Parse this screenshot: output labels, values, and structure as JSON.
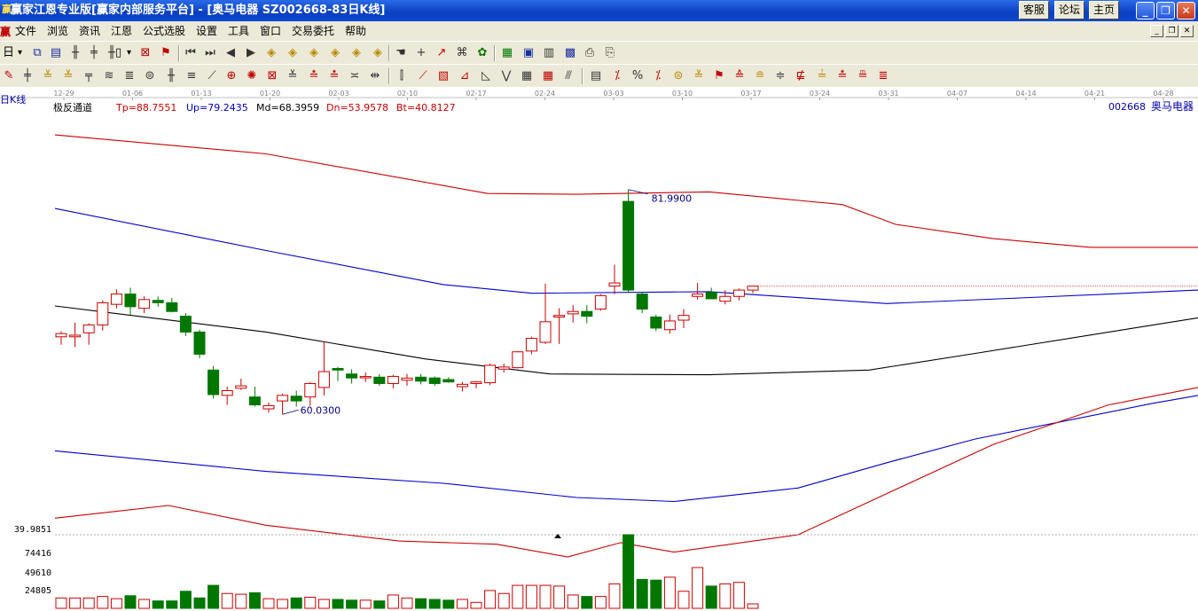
{
  "window": {
    "title": "赢家江恩专业版[赢家内部服务平台] - [奥马电器   SZ002668-83日K线]",
    "buttons": [
      "客服",
      "论坛",
      "主页"
    ],
    "controls": [
      "_",
      "❐",
      "✕"
    ]
  },
  "menu": {
    "logo": "赢",
    "items": [
      "文件",
      "浏览",
      "资讯",
      "江恩",
      "公式选股",
      "设置",
      "工具",
      "窗口",
      "交易委托",
      "帮助"
    ],
    "mdi_controls": [
      "_",
      "❐",
      "✕"
    ]
  },
  "toolbar": {
    "period_label": "日",
    "period_arrow": "▾",
    "cursor_label": "▯",
    "cursor_arrow": "▾"
  },
  "chart": {
    "left_label": "日K线",
    "indicator_name": "极反通道",
    "params": [
      {
        "label": "Tp=88.7551",
        "color": "#cc0000"
      },
      {
        "label": "Up=79.2435",
        "color": "#0000cc"
      },
      {
        "label": "Md=68.3959",
        "color": "#000000"
      },
      {
        "label": "Dn=53.9578",
        "color": "#cc0000"
      },
      {
        "label": "Bt=40.8127",
        "color": "#cc0000"
      }
    ],
    "stock_code": "002668",
    "stock_name": "奥马电器",
    "date_ticks": [
      "12-29",
      "01-06",
      "01-13",
      "01-20",
      "02-03",
      "02-10",
      "02-17",
      "02-24",
      "03-03",
      "03-10",
      "03-17",
      "03-24",
      "03-31",
      "04-07",
      "04-14",
      "04-21",
      "04-28"
    ],
    "high_label": "81.9900",
    "low_label": "60.0300",
    "volume_ticks": [
      "39.9851",
      "74416",
      "49610",
      "24805"
    ],
    "colors": {
      "up": "#cc0000",
      "down": "#007700",
      "top": "#cc0000",
      "upper": "#0000cc",
      "mid": "#000000"
    }
  },
  "chart_data": {
    "type": "candlestick",
    "price_range": [
      38.4,
      91.6
    ],
    "volume_max": 99220,
    "candles": [
      [
        63.4,
        64.1,
        62.4,
        63.8
      ],
      [
        63.4,
        65.2,
        62.1,
        63.6
      ],
      [
        63.9,
        65.1,
        62.4,
        64.9
      ],
      [
        64.9,
        68.0,
        64.2,
        67.7
      ],
      [
        67.5,
        69.4,
        67.0,
        68.8
      ],
      [
        68.8,
        69.6,
        66.1,
        67.2
      ],
      [
        67.0,
        68.5,
        66.4,
        68.1
      ],
      [
        68.0,
        68.5,
        67.2,
        67.7
      ],
      [
        67.7,
        68.3,
        66.5,
        66.6
      ],
      [
        66.0,
        66.4,
        63.5,
        64.0
      ],
      [
        64.0,
        64.3,
        60.7,
        61.2
      ],
      [
        59.2,
        59.7,
        55.6,
        56.1
      ],
      [
        56.0,
        57.1,
        54.8,
        56.6
      ],
      [
        56.9,
        58.1,
        56.7,
        57.2
      ],
      [
        55.8,
        57.1,
        54.6,
        54.8
      ],
      [
        54.3,
        55.1,
        53.8,
        54.7
      ],
      [
        55.3,
        56.2,
        53.6,
        56.0
      ],
      [
        55.9,
        56.6,
        54.6,
        55.3
      ],
      [
        55.8,
        57.7,
        54.7,
        57.5
      ],
      [
        57.0,
        62.8,
        56.0,
        59.0
      ],
      [
        59.4,
        59.6,
        57.8,
        59.2
      ],
      [
        58.7,
        59.3,
        57.5,
        58.2
      ],
      [
        58.3,
        58.9,
        57.7,
        58.3
      ],
      [
        58.3,
        58.7,
        57.2,
        57.5
      ],
      [
        57.5,
        58.6,
        56.9,
        58.4
      ],
      [
        58.0,
        58.7,
        57.2,
        58.1
      ],
      [
        58.3,
        58.7,
        57.4,
        57.8
      ],
      [
        58.2,
        58.4,
        57.2,
        57.5
      ],
      [
        58.0,
        58.3,
        57.6,
        57.7
      ],
      [
        57.1,
        57.7,
        56.5,
        57.4
      ],
      [
        57.5,
        57.8,
        56.9,
        57.7
      ],
      [
        57.6,
        60.0,
        57.3,
        59.8
      ],
      [
        59.4,
        60.0,
        58.9,
        59.5
      ],
      [
        59.5,
        61.6,
        59.4,
        61.5
      ],
      [
        61.6,
        63.4,
        61.2,
        63.2
      ],
      [
        62.7,
        70.1,
        62.5,
        65.3
      ],
      [
        65.9,
        67.0,
        62.5,
        66.1
      ],
      [
        66.3,
        67.4,
        65.2,
        66.6
      ],
      [
        66.6,
        67.4,
        65.1,
        66.0
      ],
      [
        66.9,
        68.8,
        66.7,
        68.6
      ],
      [
        69.8,
        72.5,
        68.8,
        70.2
      ],
      [
        80.5,
        82.0,
        69.0,
        69.3
      ],
      [
        68.8,
        69.1,
        66.4,
        66.9
      ],
      [
        65.9,
        66.2,
        64.1,
        64.5
      ],
      [
        64.3,
        66.2,
        63.8,
        65.4
      ],
      [
        65.5,
        66.9,
        64.5,
        66.1
      ],
      [
        68.5,
        70.2,
        68.1,
        68.8
      ],
      [
        69.0,
        69.6,
        68.3,
        68.2
      ],
      [
        67.9,
        69.3,
        67.5,
        68.5
      ],
      [
        68.5,
        69.5,
        68.0,
        69.3
      ],
      [
        69.3,
        69.7,
        68.9,
        69.8
      ]
    ],
    "volumes": [
      14000,
      14000,
      14000,
      16000,
      13000,
      17000,
      12000,
      10000,
      10000,
      23000,
      14000,
      31000,
      20000,
      19000,
      21000,
      13000,
      12000,
      14000,
      15000,
      12000,
      12000,
      11000,
      11000,
      10000,
      18000,
      14000,
      13000,
      12000,
      11000,
      12000,
      8000,
      24000,
      20000,
      31000,
      31000,
      31000,
      30000,
      18000,
      16000,
      16000,
      33000,
      99220,
      39000,
      38000,
      42000,
      23000,
      55000,
      30000,
      33000,
      35000,
      6000
    ],
    "bands": {
      "tp": [
        [
          62,
          88.9
        ],
        [
          300,
          86.5
        ],
        [
          550,
          81.5
        ],
        [
          650,
          81.4
        ],
        [
          800,
          81.7
        ],
        [
          950,
          80.1
        ],
        [
          1010,
          77.6
        ],
        [
          1120,
          75.8
        ],
        [
          1230,
          74.7
        ],
        [
          1351,
          74.7
        ]
      ],
      "up": [
        [
          62,
          79.6
        ],
        [
          300,
          74.3
        ],
        [
          500,
          70.0
        ],
        [
          600,
          68.9
        ],
        [
          800,
          69.1
        ],
        [
          1000,
          67.6
        ],
        [
          1150,
          68.3
        ],
        [
          1351,
          69.3
        ]
      ],
      "md": [
        [
          62,
          67.3
        ],
        [
          300,
          64.0
        ],
        [
          480,
          60.6
        ],
        [
          620,
          58.7
        ],
        [
          800,
          58.6
        ],
        [
          980,
          59.2
        ],
        [
          1100,
          61.3
        ],
        [
          1351,
          65.8
        ]
      ],
      "dn": [
        [
          62,
          49.0
        ],
        [
          300,
          46.4
        ],
        [
          500,
          44.9
        ],
        [
          650,
          43.1
        ],
        [
          760,
          42.6
        ],
        [
          900,
          44.3
        ],
        [
          1000,
          47.5
        ],
        [
          1100,
          50.5
        ],
        [
          1300,
          55.0
        ],
        [
          1351,
          56.0
        ]
      ],
      "bt": [
        [
          62,
          40.5
        ],
        [
          190,
          42.1
        ],
        [
          300,
          39.6
        ],
        [
          450,
          37.6
        ],
        [
          560,
          37.2
        ],
        [
          640,
          35.6
        ],
        [
          700,
          37.4
        ],
        [
          760,
          36.2
        ],
        [
          900,
          38.4
        ],
        [
          1000,
          43.6
        ],
        [
          1120,
          49.8
        ],
        [
          1250,
          54.8
        ],
        [
          1351,
          57.0
        ]
      ]
    }
  }
}
